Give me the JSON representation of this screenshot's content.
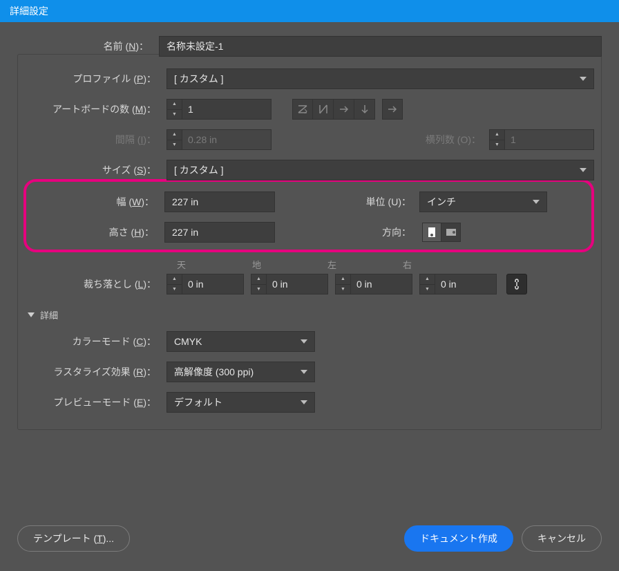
{
  "title": "詳細設定",
  "labels": {
    "name": "名前 (",
    "name_u": "N",
    "profile": "プロファイル (",
    "profile_u": "P",
    "artboards": "アートボードの数 (",
    "artboards_u": "M",
    "spacing": "間隔 (",
    "spacing_u": "I",
    "columns": "横列数 (",
    "columns_u": "O",
    "size": "サイズ (",
    "size_u": "S",
    "width": "幅 (",
    "width_u": "W",
    "units": "単位 (",
    "units_u": "U",
    "height": "高さ (",
    "height_u": "H",
    "orientation": "方向：",
    "bleed": "裁ち落とし (",
    "bleed_u": "L",
    "bleed_top": "天",
    "bleed_bottom": "地",
    "bleed_left": "左",
    "bleed_right": "右",
    "advanced": "詳細",
    "colormode": "カラーモード (",
    "colormode_u": "C",
    "raster": "ラスタライズ効果 (",
    "raster_u": "R",
    "preview": "プレビューモード (",
    "preview_u": "E",
    "close": ")："
  },
  "values": {
    "name": "名称未設定-1",
    "profile": "[ カスタム ]",
    "artboards": "1",
    "spacing": "0.28 in",
    "columns": "1",
    "size": "[ カスタム ]",
    "width": "227 in",
    "units": "インチ",
    "height": "227 in",
    "bleed_top": "0 in",
    "bleed_bottom": "0 in",
    "bleed_left": "0 in",
    "bleed_right": "0 in",
    "colormode": "CMYK",
    "raster": "高解像度 (300 ppi)",
    "preview": "デフォルト"
  },
  "buttons": {
    "template": "テンプレート (",
    "template_u": "T",
    "template_suffix": ")...",
    "create": "ドキュメント作成",
    "cancel": "キャンセル"
  }
}
